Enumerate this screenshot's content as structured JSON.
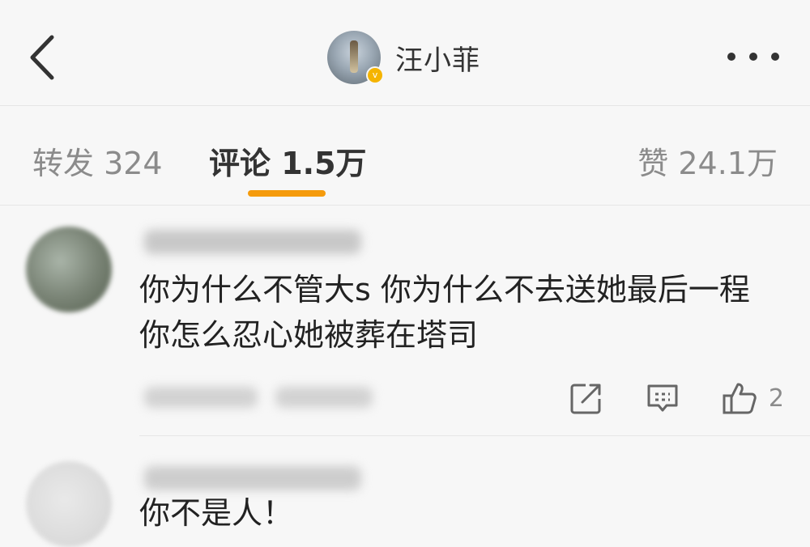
{
  "header": {
    "username": "汪小菲",
    "verified_badge": "v",
    "icons": {
      "back": "back-arrow-icon",
      "more": "more-dots-icon",
      "verified": "verified-badge-icon"
    }
  },
  "tabs": {
    "repost_label": "转发 324",
    "comment_label": "评论 1.5万",
    "like_label": "赞 24.1万",
    "active": "comment",
    "accent_color": "#f59b0c"
  },
  "comments": [
    {
      "text": "你为什么不管大s 你为什么不去送她最后一程 你怎么忍心她被葬在塔司",
      "like_count": "2",
      "icons": {
        "repost": "share-icon",
        "reply": "comment-icon",
        "like": "thumbs-up-icon"
      }
    },
    {
      "text": "你不是人！"
    }
  ]
}
